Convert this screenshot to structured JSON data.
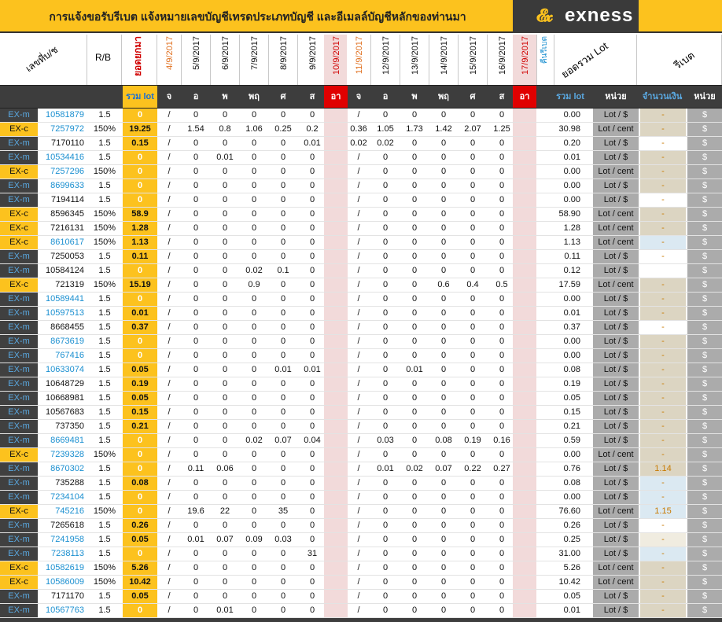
{
  "title": "การแจ้งขอรับรีเบต  แจ้งหมายเลขบัญชีเทรดประเภทบัญชี และอีเมลล์บัญชีหลักของท่านมา",
  "brand": {
    "mark": "𝓔𝔁",
    "name": "exness"
  },
  "headers": {
    "account_no": "เลขที่บ/ช",
    "rb": "R/B",
    "opening": "ยอดยกมา",
    "dates": [
      "4/9/2017",
      "5/9/2017",
      "6/9/2017",
      "7/9/2017",
      "8/9/2017",
      "9/9/2017",
      "10/9/2017",
      "11/9/2017",
      "12/9/2017",
      "13/9/2017",
      "14/9/2017",
      "15/9/2017",
      "16/9/2017",
      "17/9/2017"
    ],
    "refund_period": "คืนรีเบต",
    "total_lot_label": "ยอดรวม Lot",
    "rebate_label": "รีเบต"
  },
  "subheaders": {
    "total_lot": "รวม lot",
    "days": [
      "จ",
      "อ",
      "พ",
      "พฤ",
      "ศ",
      "ส",
      "อา",
      "จ",
      "อ",
      "พ",
      "พฤ",
      "ศ",
      "ส",
      "อา"
    ],
    "sum_lot": "รวม lot",
    "unit": "หน่วย",
    "amount": "จำนวนเงิน",
    "unit2": "หน่วย"
  },
  "colors": {
    "accent": "#fcc21e",
    "dark": "#3d3d3d",
    "red": "#e00000",
    "blue": "#1a8fd0"
  },
  "rows": [
    {
      "type": "EX-m",
      "acct": "10581879",
      "blue": true,
      "rb": "1.5",
      "total": "0",
      "w1": [
        "0",
        "0",
        "0",
        "0",
        "0"
      ],
      "w2": [
        "0",
        "0",
        "0",
        "0",
        "0"
      ],
      "sum": "0.00",
      "unit": "Lot / $",
      "unitGreen": true,
      "amt": "-",
      "amtBg": "tan"
    },
    {
      "type": "EX-c",
      "acct": "7257972",
      "blue": true,
      "rb": "150%",
      "total": "19.25",
      "w1": [
        "1.54",
        "0.8",
        "1.06",
        "0.25",
        "0.2"
      ],
      "w2": [
        "0.36",
        "1.05",
        "1.73",
        "1.42",
        "2.07",
        "1.25"
      ],
      "sum": "30.98",
      "unit": "Lot / cent",
      "unitGreen": true,
      "amt": "-",
      "amtBg": "tan"
    },
    {
      "type": "EX-m",
      "acct": "7170110",
      "blue": false,
      "rb": "1.5",
      "total": "0.15",
      "w1": [
        "0",
        "0",
        "0",
        "0",
        "0.01"
      ],
      "w2": [
        "0.02",
        "0.02",
        "0",
        "0",
        "0",
        "0"
      ],
      "sum": "0.20",
      "unit": "Lot / $",
      "amt": "-",
      "amtBg": "white"
    },
    {
      "type": "EX-m",
      "acct": "10534416",
      "blue": true,
      "rb": "1.5",
      "total": "0",
      "w1": [
        "0",
        "0.01",
        "0",
        "0",
        "0"
      ],
      "w2": [
        "0",
        "0",
        "0",
        "0",
        "0"
      ],
      "sum": "0.01",
      "unit": "Lot / $",
      "amt": "-",
      "amtBg": "tan"
    },
    {
      "type": "EX-c",
      "acct": "7257296",
      "blue": true,
      "rb": "150%",
      "total": "0",
      "w1": [
        "0",
        "0",
        "0",
        "0",
        "0"
      ],
      "w2": [
        "0",
        "0",
        "0",
        "0",
        "0"
      ],
      "sum": "0.00",
      "unit": "Lot / cent",
      "amt": "-",
      "amtBg": "tan"
    },
    {
      "type": "EX-m",
      "acct": "8699633",
      "blue": true,
      "rb": "1.5",
      "total": "0",
      "w1": [
        "0",
        "0",
        "0",
        "0",
        "0"
      ],
      "w2": [
        "0",
        "0",
        "0",
        "0",
        "0"
      ],
      "sum": "0.00",
      "unit": "Lot / $",
      "amt": "-",
      "amtBg": "tan"
    },
    {
      "type": "EX-m",
      "acct": "7194114",
      "blue": false,
      "rb": "1.5",
      "total": "0",
      "w1": [
        "0",
        "0",
        "0",
        "0",
        "0"
      ],
      "w2": [
        "0",
        "0",
        "0",
        "0",
        "0"
      ],
      "sum": "0.00",
      "unit": "Lot / $",
      "amt": "-",
      "amtBg": "white"
    },
    {
      "type": "EX-c",
      "acct": "8596345",
      "blue": false,
      "rb": "150%",
      "total": "58.9",
      "w1": [
        "0",
        "0",
        "0",
        "0",
        "0"
      ],
      "w2": [
        "0",
        "0",
        "0",
        "0",
        "0"
      ],
      "sum": "58.90",
      "unit": "Lot / cent",
      "amt": "-",
      "amtBg": "tan"
    },
    {
      "type": "EX-c",
      "acct": "7216131",
      "blue": false,
      "rb": "150%",
      "total": "1.28",
      "w1": [
        "0",
        "0",
        "0",
        "0",
        "0"
      ],
      "w2": [
        "0",
        "0",
        "0",
        "0",
        "0"
      ],
      "sum": "1.28",
      "unit": "Lot / cent",
      "amt": "-",
      "amtBg": "tan"
    },
    {
      "type": "EX-c",
      "acct": "8610617",
      "blue": true,
      "rb": "150%",
      "total": "1.13",
      "w1": [
        "0",
        "0",
        "0",
        "0",
        "0"
      ],
      "w2": [
        "0",
        "0",
        "0",
        "0",
        "0"
      ],
      "sum": "1.13",
      "unit": "Lot / cent",
      "amt": "-",
      "amtBg": "blue"
    },
    {
      "type": "EX-m",
      "acct": "7250053",
      "blue": false,
      "rb": "1.5",
      "total": "0.11",
      "w1": [
        "0",
        "0",
        "0",
        "0",
        "0"
      ],
      "w2": [
        "0",
        "0",
        "0",
        "0",
        "0"
      ],
      "sum": "0.11",
      "unit": "Lot / $",
      "amt": "-",
      "amtBg": "white"
    },
    {
      "type": "EX-m",
      "acct": "10584124",
      "blue": false,
      "rb": "1.5",
      "total": "0",
      "w1": [
        "0",
        "0",
        "0.02",
        "0.1",
        "0"
      ],
      "w2": [
        "0",
        "0",
        "0",
        "0",
        "0"
      ],
      "sum": "0.12",
      "unit": "Lot / $",
      "amt": "",
      "amtBg": "white"
    },
    {
      "type": "EX-c",
      "acct": "721319",
      "blue": false,
      "rb": "150%",
      "total": "15.19",
      "w1": [
        "0",
        "0",
        "0.9",
        "0",
        "0"
      ],
      "w2": [
        "0",
        "0",
        "0.6",
        "0.4",
        "0.5"
      ],
      "sum": "17.59",
      "unit": "Lot / cent",
      "amt": "-",
      "amtBg": "tan"
    },
    {
      "type": "EX-m",
      "acct": "10589441",
      "blue": true,
      "rb": "1.5",
      "total": "0",
      "w1": [
        "0",
        "0",
        "0",
        "0",
        "0"
      ],
      "w2": [
        "0",
        "0",
        "0",
        "0",
        "0"
      ],
      "sum": "0.00",
      "unit": "Lot / $",
      "amt": "-",
      "amtBg": "tan"
    },
    {
      "type": "EX-m",
      "acct": "10597513",
      "blue": true,
      "rb": "1.5",
      "total": "0.01",
      "w1": [
        "0",
        "0",
        "0",
        "0",
        "0"
      ],
      "w2": [
        "0",
        "0",
        "0",
        "0",
        "0"
      ],
      "sum": "0.01",
      "unit": "Lot / $",
      "amt": "-",
      "amtBg": "tan"
    },
    {
      "type": "EX-m",
      "acct": "8668455",
      "blue": false,
      "rb": "1.5",
      "total": "0.37",
      "w1": [
        "0",
        "0",
        "0",
        "0",
        "0"
      ],
      "w2": [
        "0",
        "0",
        "0",
        "0",
        "0"
      ],
      "sum": "0.37",
      "unit": "Lot / $",
      "amt": "-",
      "amtBg": "white"
    },
    {
      "type": "EX-m",
      "acct": "8673619",
      "blue": true,
      "rb": "1.5",
      "total": "0",
      "w1": [
        "0",
        "0",
        "0",
        "0",
        "0"
      ],
      "w2": [
        "0",
        "0",
        "0",
        "0",
        "0"
      ],
      "sum": "0.00",
      "unit": "Lot / $",
      "amt": "-",
      "amtBg": "tan"
    },
    {
      "type": "EX-m",
      "acct": "767416",
      "blue": true,
      "rb": "1.5",
      "total": "0",
      "w1": [
        "0",
        "0",
        "0",
        "0",
        "0"
      ],
      "w2": [
        "0",
        "0",
        "0",
        "0",
        "0"
      ],
      "sum": "0.00",
      "unit": "Lot / $",
      "amt": "-",
      "amtBg": "tan"
    },
    {
      "type": "EX-m",
      "acct": "10633074",
      "blue": true,
      "rb": "1.5",
      "total": "0.05",
      "w1": [
        "0",
        "0",
        "0",
        "0.01",
        "0.01"
      ],
      "w2": [
        "0",
        "0.01",
        "0",
        "0",
        "0"
      ],
      "sum": "0.08",
      "unit": "Lot / $",
      "amt": "-",
      "amtBg": "tan"
    },
    {
      "type": "EX-m",
      "acct": "10648729",
      "blue": false,
      "rb": "1.5",
      "total": "0.19",
      "w1": [
        "0",
        "0",
        "0",
        "0",
        "0"
      ],
      "w2": [
        "0",
        "0",
        "0",
        "0",
        "0"
      ],
      "sum": "0.19",
      "unit": "Lot / $",
      "amt": "-",
      "amtBg": "tan"
    },
    {
      "type": "EX-m",
      "acct": "10668981",
      "blue": false,
      "rb": "1.5",
      "total": "0.05",
      "w1": [
        "0",
        "0",
        "0",
        "0",
        "0"
      ],
      "w2": [
        "0",
        "0",
        "0",
        "0",
        "0"
      ],
      "sum": "0.05",
      "unit": "Lot / $",
      "amt": "-",
      "amtBg": "tan"
    },
    {
      "type": "EX-m",
      "acct": "10567683",
      "blue": false,
      "rb": "1.5",
      "total": "0.15",
      "w1": [
        "0",
        "0",
        "0",
        "0",
        "0"
      ],
      "w2": [
        "0",
        "0",
        "0",
        "0",
        "0"
      ],
      "sum": "0.15",
      "unit": "Lot / $",
      "amt": "-",
      "amtBg": "tan"
    },
    {
      "type": "EX-m",
      "acct": "737350",
      "blue": false,
      "rb": "1.5",
      "total": "0.21",
      "w1": [
        "0",
        "0",
        "0",
        "0",
        "0"
      ],
      "w2": [
        "0",
        "0",
        "0",
        "0",
        "0"
      ],
      "sum": "0.21",
      "unit": "Lot / $",
      "amt": "-",
      "amtBg": "tan"
    },
    {
      "type": "EX-m",
      "acct": "8669481",
      "blue": true,
      "rb": "1.5",
      "total": "0",
      "w1": [
        "0",
        "0",
        "0.02",
        "0.07",
        "0.04"
      ],
      "w2": [
        "0.03",
        "0",
        "0.08",
        "0.19",
        "0.16"
      ],
      "sum": "0.59",
      "unit": "Lot / $",
      "amt": "-",
      "amtBg": "tan"
    },
    {
      "type": "EX-c",
      "acct": "7239328",
      "blue": true,
      "rb": "150%",
      "total": "0",
      "w1": [
        "0",
        "0",
        "0",
        "0",
        "0"
      ],
      "w2": [
        "0",
        "0",
        "0",
        "0",
        "0"
      ],
      "sum": "0.00",
      "unit": "Lot / cent",
      "amt": "-",
      "amtBg": "tan"
    },
    {
      "type": "EX-m",
      "acct": "8670302",
      "blue": true,
      "rb": "1.5",
      "total": "0",
      "w1": [
        "0.11",
        "0.06",
        "0",
        "0",
        "0"
      ],
      "w2": [
        "0.01",
        "0.02",
        "0.07",
        "0.22",
        "0.27"
      ],
      "sum": "0.76",
      "unit": "Lot / $",
      "amt": "1.14",
      "amtBg": "tan"
    },
    {
      "type": "EX-m",
      "acct": "735288",
      "blue": false,
      "rb": "1.5",
      "total": "0.08",
      "w1": [
        "0",
        "0",
        "0",
        "0",
        "0"
      ],
      "w2": [
        "0",
        "0",
        "0",
        "0",
        "0"
      ],
      "sum": "0.08",
      "unit": "Lot / $",
      "amt": "-",
      "amtBg": "blue"
    },
    {
      "type": "EX-m",
      "acct": "7234104",
      "blue": true,
      "rb": "1.5",
      "total": "0",
      "w1": [
        "0",
        "0",
        "0",
        "0",
        "0"
      ],
      "w2": [
        "0",
        "0",
        "0",
        "0",
        "0"
      ],
      "sum": "0.00",
      "unit": "Lot / $",
      "amt": "-",
      "amtBg": "blue"
    },
    {
      "type": "EX-c",
      "acct": "745216",
      "blue": true,
      "rb": "150%",
      "total": "0",
      "w1": [
        "19.6",
        "22",
        "0",
        "35",
        "0"
      ],
      "w2": [
        "0",
        "0",
        "0",
        "0",
        "0"
      ],
      "sum": "76.60",
      "unit": "Lot / cent",
      "amt": "1.15",
      "amtBg": "blue"
    },
    {
      "type": "EX-m",
      "acct": "7265618",
      "blue": false,
      "rb": "1.5",
      "total": "0.26",
      "w1": [
        "0",
        "0",
        "0",
        "0",
        "0"
      ],
      "w2": [
        "0",
        "0",
        "0",
        "0",
        "0"
      ],
      "sum": "0.26",
      "unit": "Lot / $",
      "amt": "-",
      "amtBg": "white"
    },
    {
      "type": "EX-m",
      "acct": "7241958",
      "blue": true,
      "rb": "1.5",
      "total": "0.05",
      "w1": [
        "0.01",
        "0.07",
        "0.09",
        "0.03",
        "0"
      ],
      "w2": [
        "0",
        "0",
        "0",
        "0",
        "0"
      ],
      "sum": "0.25",
      "unit": "Lot / $",
      "amt": "-",
      "amtBg": "pale"
    },
    {
      "type": "EX-m",
      "acct": "7238113",
      "blue": true,
      "rb": "1.5",
      "total": "0",
      "w1": [
        "0",
        "0",
        "0",
        "0",
        "31"
      ],
      "w2": [
        "0",
        "0",
        "0",
        "0",
        "0"
      ],
      "sum": "31.00",
      "unit": "Lot / $",
      "amt": "-",
      "amtBg": "blue"
    },
    {
      "type": "EX-c",
      "acct": "10582619",
      "blue": true,
      "rb": "150%",
      "total": "5.26",
      "w1": [
        "0",
        "0",
        "0",
        "0",
        "0"
      ],
      "w2": [
        "0",
        "0",
        "0",
        "0",
        "0"
      ],
      "sum": "5.26",
      "unit": "Lot / cent",
      "amt": "-",
      "amtBg": "tan"
    },
    {
      "type": "EX-c",
      "acct": "10586009",
      "blue": true,
      "rb": "150%",
      "total": "10.42",
      "w1": [
        "0",
        "0",
        "0",
        "0",
        "0"
      ],
      "w2": [
        "0",
        "0",
        "0",
        "0",
        "0"
      ],
      "sum": "10.42",
      "unit": "Lot / cent",
      "amt": "-",
      "amtBg": "tan"
    },
    {
      "type": "EX-m",
      "acct": "7171170",
      "blue": false,
      "rb": "1.5",
      "total": "0.05",
      "w1": [
        "0",
        "0",
        "0",
        "0",
        "0"
      ],
      "w2": [
        "0",
        "0",
        "0",
        "0",
        "0"
      ],
      "sum": "0.05",
      "unit": "Lot / $",
      "amt": "-",
      "amtBg": "tan"
    },
    {
      "type": "EX-m",
      "acct": "10567763",
      "blue": true,
      "rb": "1.5",
      "total": "0",
      "w1": [
        "0",
        "0.01",
        "0",
        "0",
        "0"
      ],
      "w2": [
        "0",
        "0",
        "0",
        "0",
        "0"
      ],
      "sum": "0.01",
      "unit": "Lot / $",
      "amt": "-",
      "amtBg": "tan"
    }
  ],
  "currency": "$",
  "slash": "/"
}
